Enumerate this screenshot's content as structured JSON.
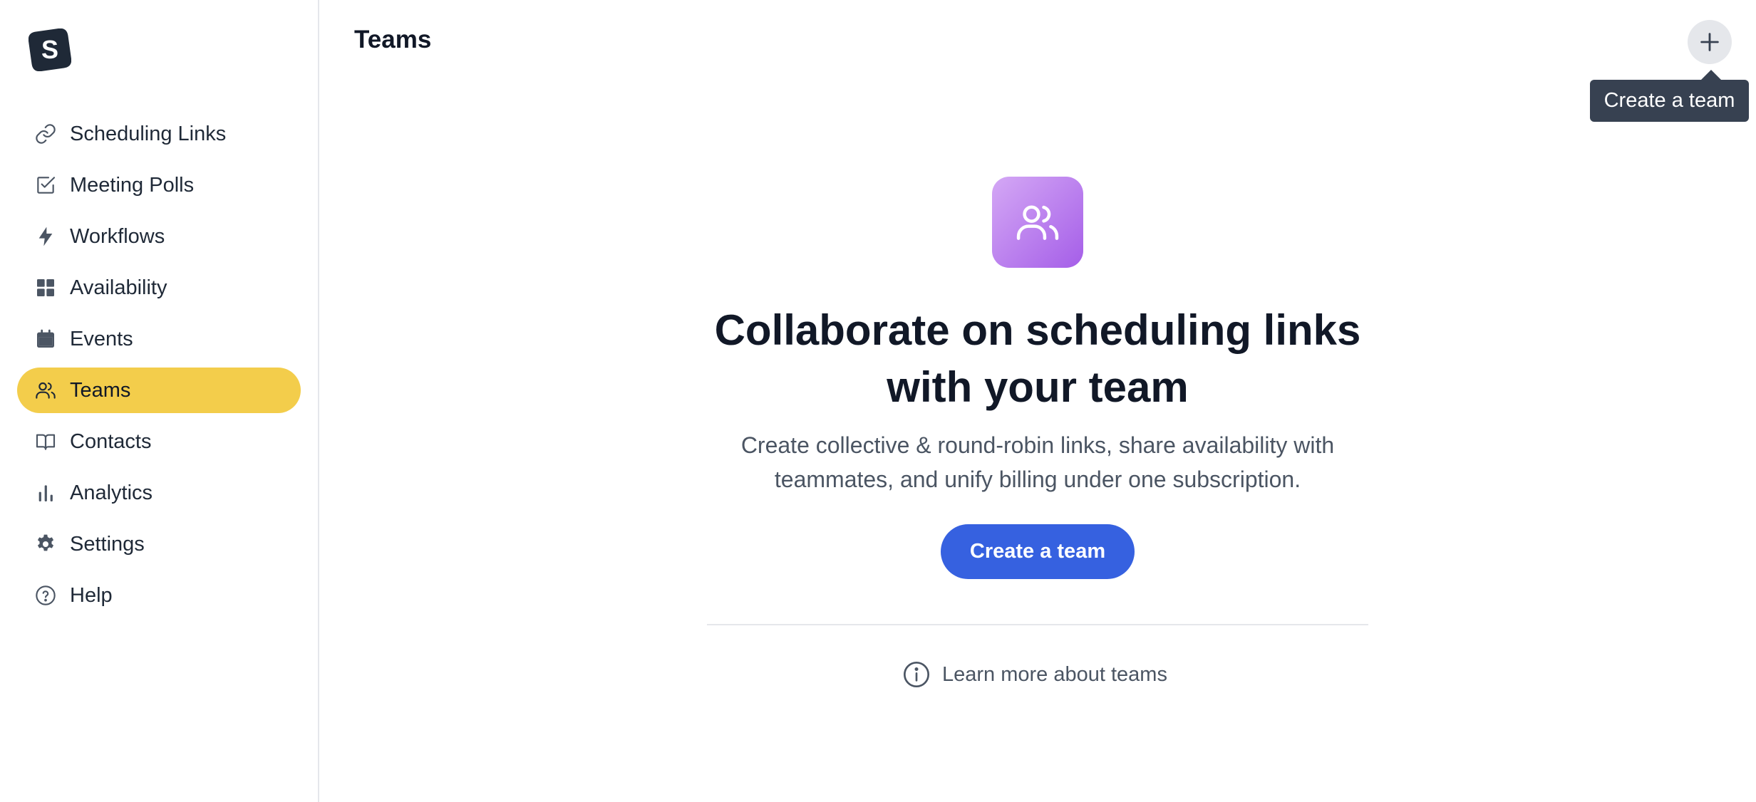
{
  "app": {
    "logo_letter": "S"
  },
  "sidebar": {
    "items": [
      {
        "label": "Scheduling Links",
        "icon": "link-icon",
        "active": false
      },
      {
        "label": "Meeting Polls",
        "icon": "checkbox-icon",
        "active": false
      },
      {
        "label": "Workflows",
        "icon": "lightning-icon",
        "active": false
      },
      {
        "label": "Availability",
        "icon": "grid-icon",
        "active": false
      },
      {
        "label": "Events",
        "icon": "calendar-icon",
        "active": false
      },
      {
        "label": "Teams",
        "icon": "users-icon",
        "active": true
      },
      {
        "label": "Contacts",
        "icon": "book-icon",
        "active": false
      },
      {
        "label": "Analytics",
        "icon": "bar-chart-icon",
        "active": false
      },
      {
        "label": "Settings",
        "icon": "gear-icon",
        "active": false
      },
      {
        "label": "Help",
        "icon": "help-circle-icon",
        "active": false
      }
    ]
  },
  "header": {
    "title": "Teams",
    "add_tooltip": "Create a team"
  },
  "main": {
    "headline": "Collaborate on scheduling links with your team",
    "description": "Create collective & round-robin links, share availability with teammates, and unify billing under one subscription.",
    "cta_label": "Create a team",
    "learn_more_label": "Learn more about teams"
  },
  "colors": {
    "active_nav": "#f3cd4b",
    "primary": "#3661e0",
    "hero_gradient_start": "#d4a8f5",
    "hero_gradient_end": "#a55ee8"
  }
}
